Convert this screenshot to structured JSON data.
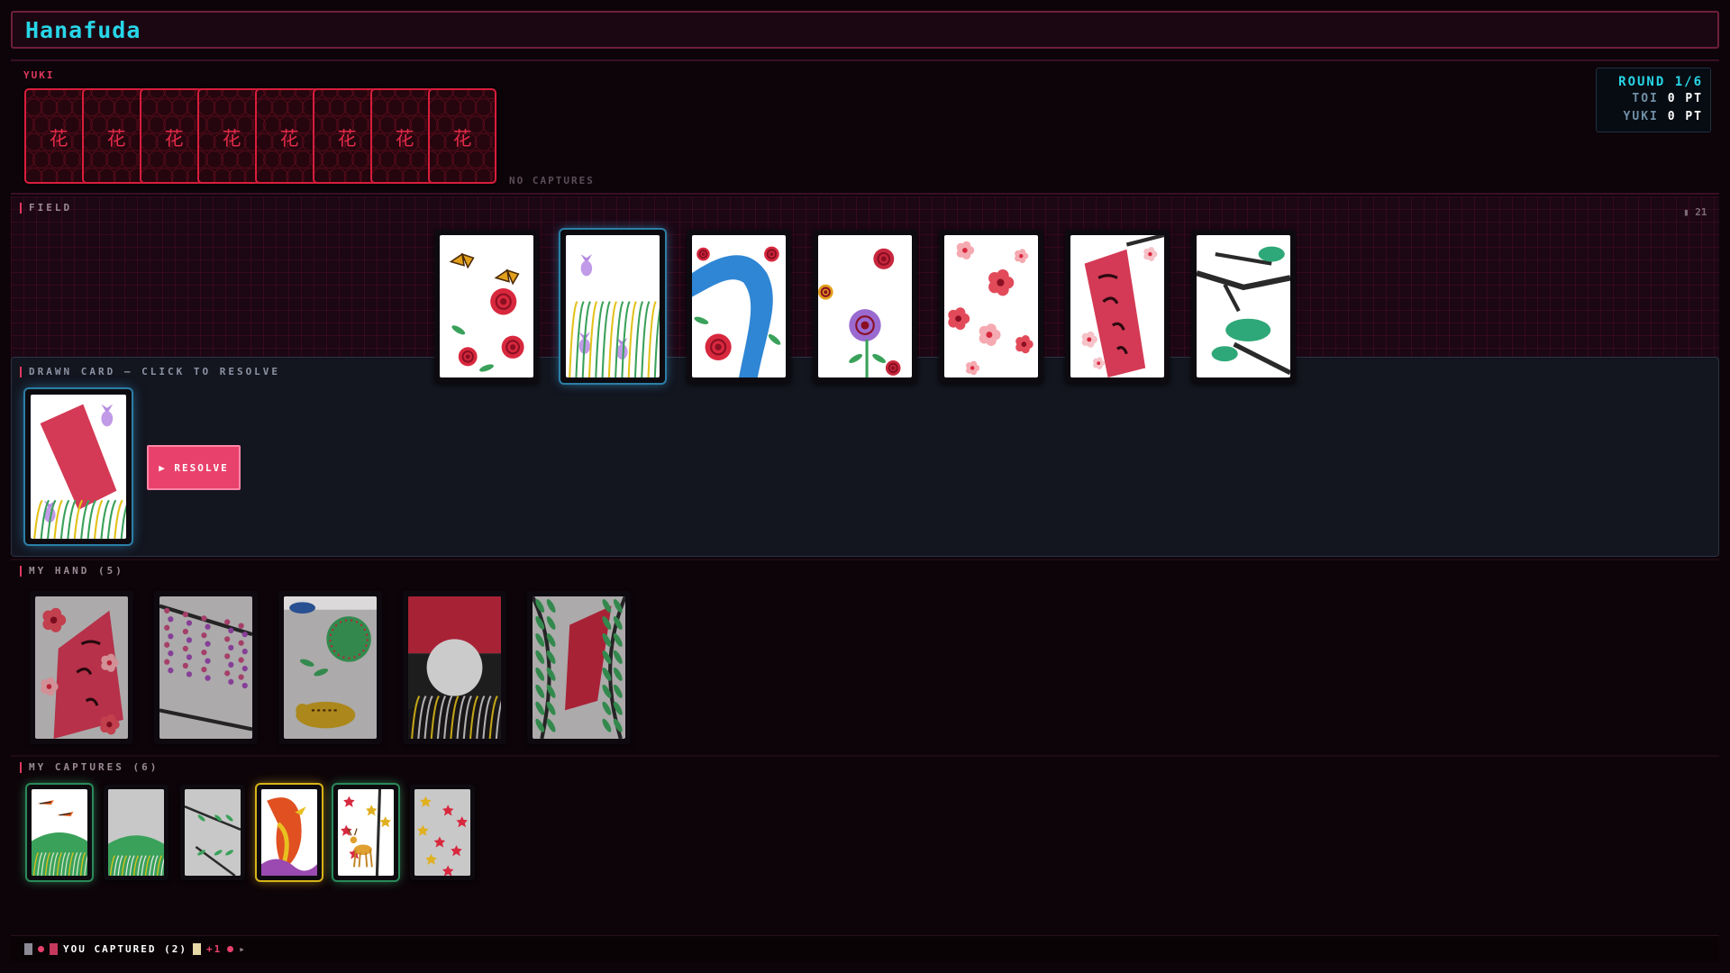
{
  "app": {
    "title": "Hanafuda"
  },
  "opponent": {
    "name": "YUKI",
    "hand_count": 8,
    "back_glyph": "花",
    "captures_text": "NO CAPTURES"
  },
  "scoreboard": {
    "round": "ROUND 1/6",
    "players": [
      {
        "name": "TOI",
        "points": "0 PT"
      },
      {
        "name": "YUKI",
        "points": "0 PT"
      }
    ]
  },
  "field": {
    "label": "FIELD",
    "deck_count": "21",
    "cards": [
      "peony-butterflies",
      "iris",
      "peony-blue-ribbon",
      "peony",
      "cherry-blossom",
      "plum-poetry-ribbon",
      "pine"
    ],
    "selected_index": 1
  },
  "drawn": {
    "label": "DRAWN CARD — CLICK TO RESOLVE",
    "card": "iris-red-ribbon",
    "resolve_label": "▶ RESOLVE"
  },
  "my_hand": {
    "label": "MY HAND (5)",
    "cards": [
      "cherry-poetry-ribbon",
      "wisteria",
      "bush-clover-boar",
      "pampas-moon",
      "willow-ribbon"
    ]
  },
  "my_captures": {
    "label": "MY CAPTURES (6)",
    "cards": [
      "pampas-geese",
      "pampas-plain",
      "willow-plain",
      "paulownia-phoenix",
      "maple-deer",
      "maple-plain"
    ]
  },
  "log": {
    "text": "YOU CAPTURED (2)",
    "bonus": "+1",
    "arrow": "▸"
  },
  "colors": {
    "accent": "#e8416c",
    "cyan": "#27d6e8",
    "card_back_red": "#d81e3c",
    "highlight_blue": "#2b7fa6",
    "highlight_gold": "#d8b418"
  }
}
